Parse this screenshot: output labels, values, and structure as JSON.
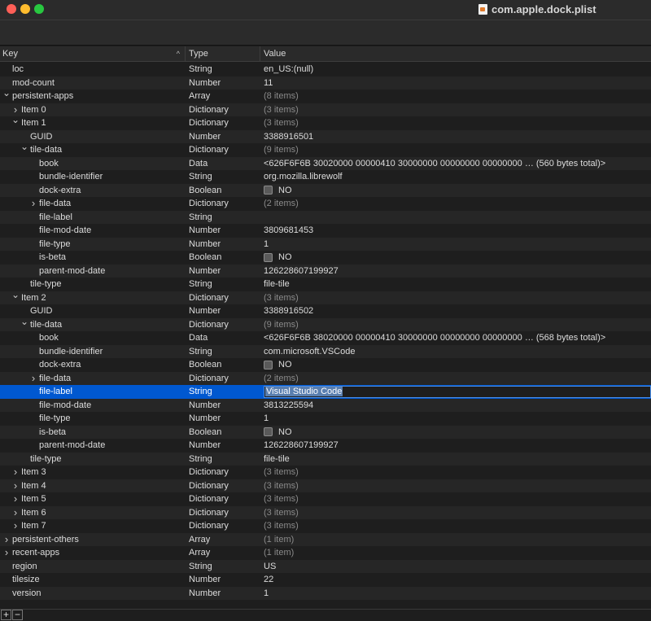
{
  "window": {
    "title": "com.apple.dock.plist"
  },
  "header": {
    "key": "Key",
    "type": "Type",
    "value": "Value"
  },
  "bottom": {
    "add": "+",
    "remove": "−"
  },
  "rows": [
    {
      "key": "loc",
      "type": "String",
      "value": "en_US:(null)",
      "depth": 0,
      "disc": "none"
    },
    {
      "key": "mod-count",
      "type": "Number",
      "value": "11",
      "depth": 0,
      "disc": "none"
    },
    {
      "key": "persistent-apps",
      "type": "Array",
      "value": "(8 items)",
      "depth": 0,
      "disc": "open",
      "dim": true
    },
    {
      "key": "Item 0",
      "type": "Dictionary",
      "value": "(3 items)",
      "depth": 1,
      "disc": "closed",
      "dim": true
    },
    {
      "key": "Item 1",
      "type": "Dictionary",
      "value": "(3 items)",
      "depth": 1,
      "disc": "open",
      "dim": true
    },
    {
      "key": "GUID",
      "type": "Number",
      "value": "3388916501",
      "depth": 2,
      "disc": "none"
    },
    {
      "key": "tile-data",
      "type": "Dictionary",
      "value": "(9 items)",
      "depth": 2,
      "disc": "open",
      "dim": true
    },
    {
      "key": "book",
      "type": "Data",
      "value": "<626F6F6B 30020000 00000410 30000000 00000000 00000000 … (560 bytes total)>",
      "depth": 3,
      "disc": "none"
    },
    {
      "key": "bundle-identifier",
      "type": "String",
      "value": "org.mozilla.librewolf",
      "depth": 3,
      "disc": "none"
    },
    {
      "key": "dock-extra",
      "type": "Boolean",
      "value": "NO",
      "depth": 3,
      "disc": "none",
      "bool": true
    },
    {
      "key": "file-data",
      "type": "Dictionary",
      "value": "(2 items)",
      "depth": 3,
      "disc": "closed",
      "dim": true
    },
    {
      "key": "file-label",
      "type": "String",
      "value": "",
      "depth": 3,
      "disc": "none"
    },
    {
      "key": "file-mod-date",
      "type": "Number",
      "value": "3809681453",
      "depth": 3,
      "disc": "none"
    },
    {
      "key": "file-type",
      "type": "Number",
      "value": "1",
      "depth": 3,
      "disc": "none"
    },
    {
      "key": "is-beta",
      "type": "Boolean",
      "value": "NO",
      "depth": 3,
      "disc": "none",
      "bool": true
    },
    {
      "key": "parent-mod-date",
      "type": "Number",
      "value": "126228607199927",
      "depth": 3,
      "disc": "none"
    },
    {
      "key": "tile-type",
      "type": "String",
      "value": "file-tile",
      "depth": 2,
      "disc": "none"
    },
    {
      "key": "Item 2",
      "type": "Dictionary",
      "value": "(3 items)",
      "depth": 1,
      "disc": "open",
      "dim": true
    },
    {
      "key": "GUID",
      "type": "Number",
      "value": "3388916502",
      "depth": 2,
      "disc": "none"
    },
    {
      "key": "tile-data",
      "type": "Dictionary",
      "value": "(9 items)",
      "depth": 2,
      "disc": "open",
      "dim": true
    },
    {
      "key": "book",
      "type": "Data",
      "value": "<626F6F6B 38020000 00000410 30000000 00000000 00000000 … (568 bytes total)>",
      "depth": 3,
      "disc": "none"
    },
    {
      "key": "bundle-identifier",
      "type": "String",
      "value": "com.microsoft.VSCode",
      "depth": 3,
      "disc": "none"
    },
    {
      "key": "dock-extra",
      "type": "Boolean",
      "value": "NO",
      "depth": 3,
      "disc": "none",
      "bool": true
    },
    {
      "key": "file-data",
      "type": "Dictionary",
      "value": "(2 items)",
      "depth": 3,
      "disc": "closed",
      "dim": true
    },
    {
      "key": "file-label",
      "type": "String",
      "value": "Visual Studio Code",
      "depth": 3,
      "disc": "none",
      "selected": true,
      "editing": true
    },
    {
      "key": "file-mod-date",
      "type": "Number",
      "value": "3813225594",
      "depth": 3,
      "disc": "none"
    },
    {
      "key": "file-type",
      "type": "Number",
      "value": "1",
      "depth": 3,
      "disc": "none"
    },
    {
      "key": "is-beta",
      "type": "Boolean",
      "value": "NO",
      "depth": 3,
      "disc": "none",
      "bool": true
    },
    {
      "key": "parent-mod-date",
      "type": "Number",
      "value": "126228607199927",
      "depth": 3,
      "disc": "none"
    },
    {
      "key": "tile-type",
      "type": "String",
      "value": "file-tile",
      "depth": 2,
      "disc": "none"
    },
    {
      "key": "Item 3",
      "type": "Dictionary",
      "value": "(3 items)",
      "depth": 1,
      "disc": "closed",
      "dim": true
    },
    {
      "key": "Item 4",
      "type": "Dictionary",
      "value": "(3 items)",
      "depth": 1,
      "disc": "closed",
      "dim": true
    },
    {
      "key": "Item 5",
      "type": "Dictionary",
      "value": "(3 items)",
      "depth": 1,
      "disc": "closed",
      "dim": true
    },
    {
      "key": "Item 6",
      "type": "Dictionary",
      "value": "(3 items)",
      "depth": 1,
      "disc": "closed",
      "dim": true
    },
    {
      "key": "Item 7",
      "type": "Dictionary",
      "value": "(3 items)",
      "depth": 1,
      "disc": "closed",
      "dim": true
    },
    {
      "key": "persistent-others",
      "type": "Array",
      "value": "(1 item)",
      "depth": 0,
      "disc": "closed",
      "dim": true
    },
    {
      "key": "recent-apps",
      "type": "Array",
      "value": "(1 item)",
      "depth": 0,
      "disc": "closed",
      "dim": true
    },
    {
      "key": "region",
      "type": "String",
      "value": "US",
      "depth": 0,
      "disc": "none"
    },
    {
      "key": "tilesize",
      "type": "Number",
      "value": "22",
      "depth": 0,
      "disc": "none"
    },
    {
      "key": "version",
      "type": "Number",
      "value": "1",
      "depth": 0,
      "disc": "none"
    }
  ]
}
